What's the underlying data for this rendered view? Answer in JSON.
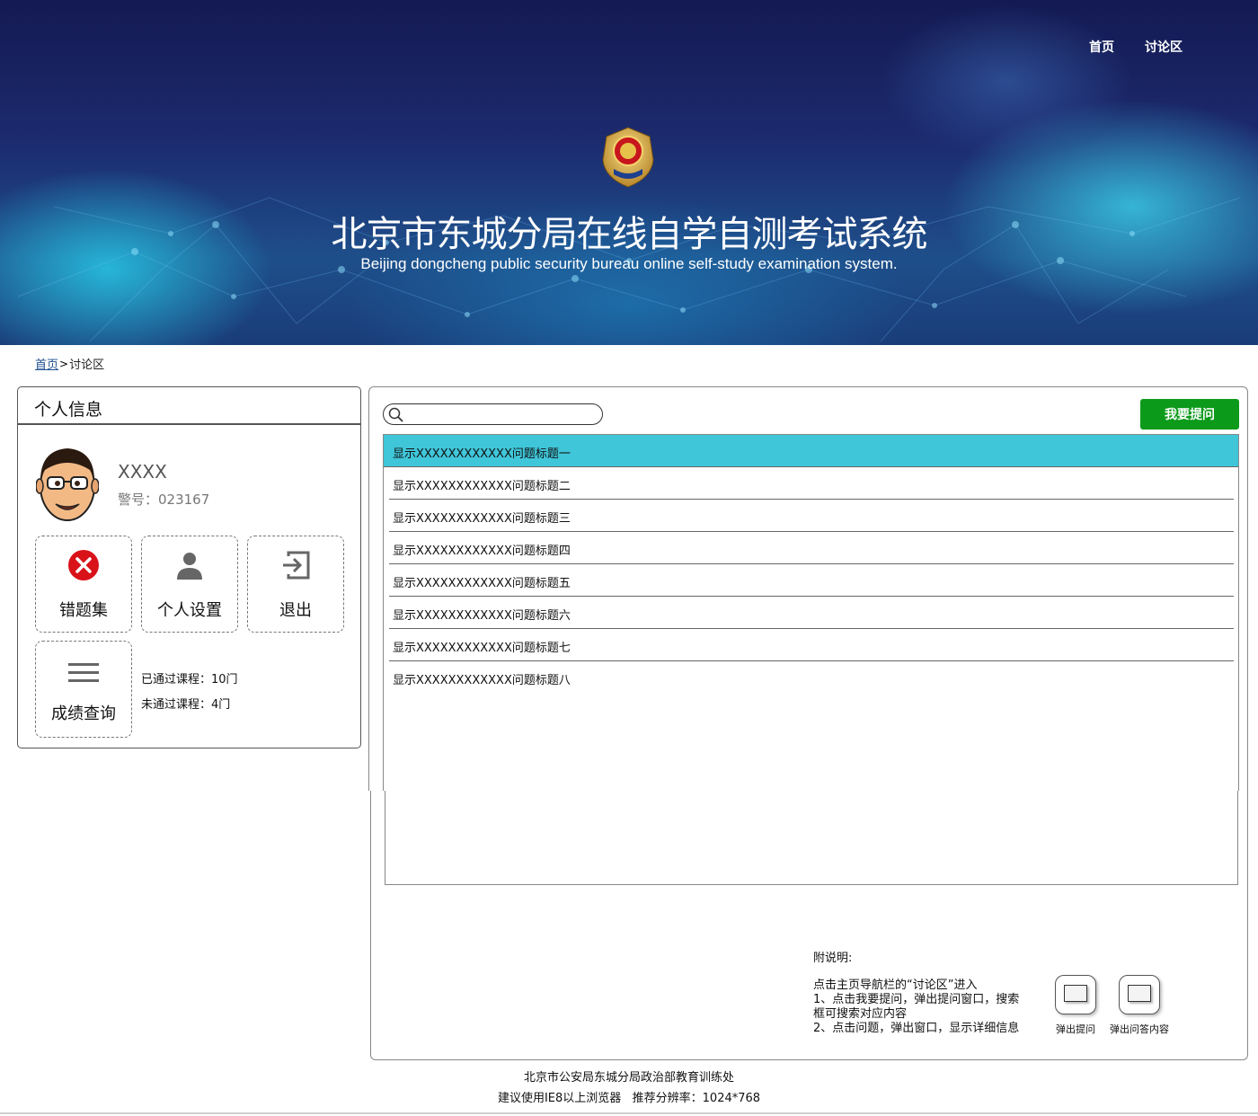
{
  "nav": {
    "home": "首页",
    "discussion": "讨论区"
  },
  "banner": {
    "title": "北京市东城分局在线自学自测考试系统",
    "subtitle": "Beijing dongcheng public security bureau online self-study examination system."
  },
  "breadcrumb": {
    "home": "首页",
    "separator": ">",
    "current": "讨论区"
  },
  "profile": {
    "heading": "个人信息",
    "name": "XXXX",
    "badge_number": "警号：023167",
    "tiles": [
      {
        "label": "错题集",
        "icon": "error-circle-icon"
      },
      {
        "label": "个人设置",
        "icon": "person-icon"
      },
      {
        "label": "退出",
        "icon": "logout-icon"
      },
      {
        "label": "成绩查询",
        "icon": "menu-icon"
      }
    ],
    "passed_courses": "已通过课程：10门",
    "failed_courses": "未通过课程：4门"
  },
  "discussion": {
    "search_placeholder": "",
    "ask_button": "我要提问",
    "questions": [
      "显示XXXXXXXXXXXX问题标题一",
      "显示XXXXXXXXXXXX问题标题二",
      "显示XXXXXXXXXXXX问题标题三",
      "显示XXXXXXXXXXXX问题标题四",
      "显示XXXXXXXXXXXX问题标题五",
      "显示XXXXXXXXXXXX问题标题六",
      "显示XXXXXXXXXXXX问题标题七",
      "显示XXXXXXXXXXXX问题标题八"
    ],
    "selected_index": 0
  },
  "notes": {
    "title": "附说明:",
    "line1": "点击主页导航栏的“讨论区”进入",
    "line2": "1、点击我要提问，弹出提问窗口，搜索框可搜索对应内容",
    "line3": "2、点击问题，弹出窗口，显示详细信息",
    "popup_ask": "弹出提问",
    "popup_answer": "弹出问答内容"
  },
  "footer": {
    "org": "北京市公安局东城分局政治部教育训练处",
    "browser_tip": "建议使用IE8以上浏览器   推荐分辨率：1024*768"
  },
  "colors": {
    "ask_button": "#0c9a1b",
    "selected_row": "#3fc6d9",
    "banner_dark": "#141a52"
  }
}
